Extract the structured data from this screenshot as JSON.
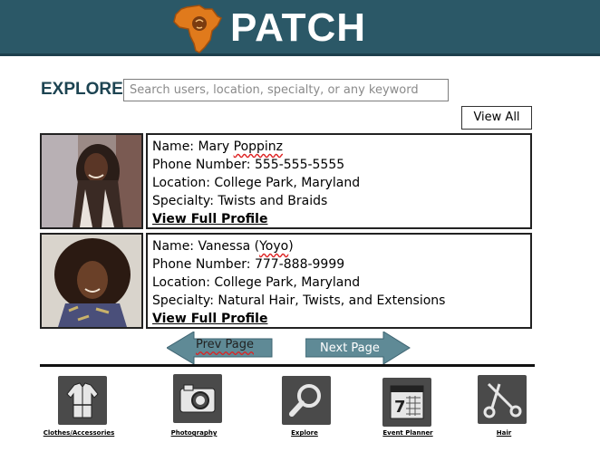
{
  "header": {
    "title": "PATCH",
    "logo_icon": "africa-map-logo",
    "colors": {
      "bar": "#2b5867",
      "logo": "#e07a1c"
    }
  },
  "explore": {
    "label": "EXPLORE",
    "search_placeholder": "Search users, location, specialty, or any keyword",
    "view_all_label": "View All"
  },
  "profiles": [
    {
      "name_label": "Name: Mary ",
      "name_flagged": "Poppinz",
      "phone": "Phone Number: 555-555-5555",
      "location": "Location: College Park, Maryland",
      "specialty": "Specialty: Twists and Braids",
      "link": "View Full Profile"
    },
    {
      "name_label": "Name: Vanessa (",
      "name_flagged": "Yoyo",
      "name_suffix": ")",
      "phone": "Phone Number: 777-888-9999",
      "location": "Location: College Park, Maryland",
      "specialty": "Specialty: Natural Hair, Twists, and Extensions",
      "link": "View Full Profile"
    }
  ],
  "pagination": {
    "prev_label": "Prev Page",
    "next_label": "Next Page",
    "arrow_color": "#5f8a96"
  },
  "categories": [
    {
      "label": "Clothes/Accessories",
      "icon": "coat-icon"
    },
    {
      "label": "Photography",
      "icon": "camera-icon"
    },
    {
      "label": "Explore",
      "icon": "magnifier-icon"
    },
    {
      "label": "Event Planner",
      "icon": "calendar-icon"
    },
    {
      "label": "Hair",
      "icon": "scissors-icon"
    }
  ]
}
